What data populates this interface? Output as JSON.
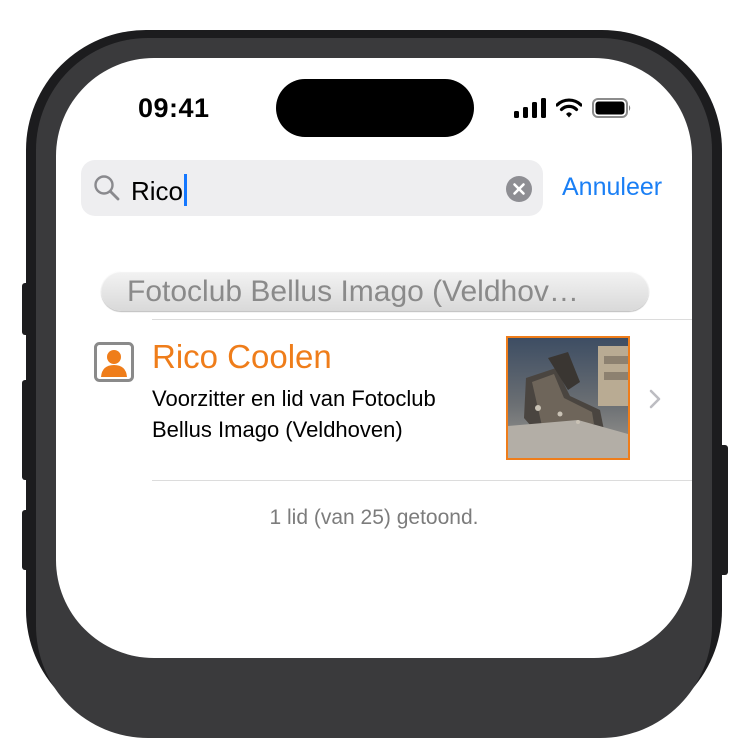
{
  "status_bar": {
    "time": "09:41"
  },
  "search": {
    "value": "Rico"
  },
  "cancel_label": "Annuleer",
  "section_header": "Fotoclub Bellus Imago (Veldhov…",
  "member": {
    "name": "Rico Coolen",
    "description": "Voorzitter en lid van Fotoclub Bellus Imago (Veldhoven)"
  },
  "footer_text": "1 lid (van 25) getoond.",
  "colors": {
    "accent": "#ef7d1a",
    "link": "#1a7ff5"
  },
  "icons": [
    "search-icon",
    "clear-icon",
    "contact-card-icon",
    "chevron-right-icon",
    "signal-icon",
    "wifi-icon",
    "battery-icon"
  ]
}
